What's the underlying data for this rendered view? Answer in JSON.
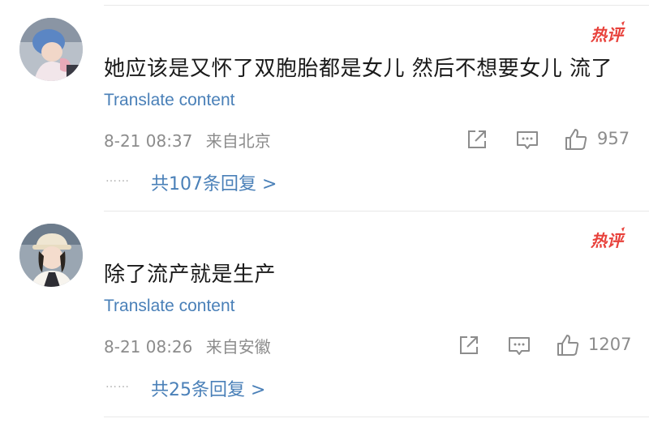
{
  "comments": [
    {
      "text": "她应该是又怀了双胞胎都是女儿 然后不想要女儿 流了",
      "badge": "热评",
      "translate_label": "Translate content",
      "date": "8-21 08:37",
      "location": "来自北京",
      "likes": "957",
      "dots": "……",
      "replies_label": "共107条回复 >"
    },
    {
      "text": "除了流产就是生产",
      "badge": "热评",
      "translate_label": "Translate content",
      "date": "8-21 08:26",
      "location": "来自安徽",
      "likes": "1207",
      "dots": "……",
      "replies_label": "共25条回复 >"
    }
  ],
  "icons": {
    "share": "share-icon",
    "comment": "comment-icon",
    "like": "thumbs-up-icon"
  },
  "colors": {
    "link": "#4a80b8",
    "badge": "#e8423c",
    "meta": "#8c8c8c"
  }
}
